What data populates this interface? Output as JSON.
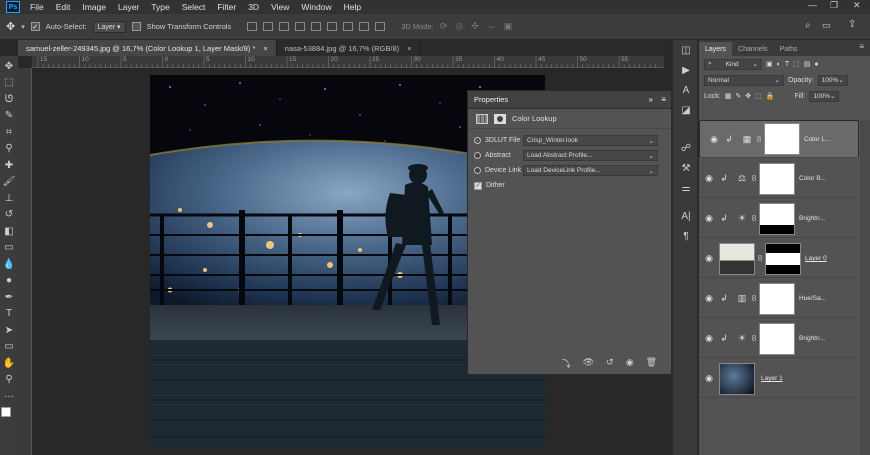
{
  "app": {
    "logo": "Ps"
  },
  "menu": [
    "File",
    "Edit",
    "Image",
    "Layer",
    "Type",
    "Select",
    "Filter",
    "3D",
    "View",
    "Window",
    "Help"
  ],
  "window_controls": [
    "—",
    "❐",
    "✕"
  ],
  "options": {
    "auto_select_label": "Auto-Select:",
    "auto_select_value": "Layer",
    "transform_label": "Show Transform Controls",
    "mode_3d": "3D Mode:"
  },
  "tabs": [
    {
      "label": "samuel-zeller-249345.jpg @ 16,7% (Color Lookup 1, Layer Mask/8) *",
      "close": "×"
    },
    {
      "label": "nasa-53884.jpg @ 16,7% (RGB/8)",
      "close": "×"
    }
  ],
  "ruler_ticks": [
    "15",
    "10",
    "5",
    "0",
    "5",
    "10",
    "15",
    "20",
    "25",
    "30",
    "35",
    "40",
    "45",
    "50",
    "55"
  ],
  "properties": {
    "panel_title": "Properties",
    "adjustment_title": "Color Lookup",
    "rows": [
      {
        "label": "3DLUT File",
        "value": "Crisp_Winter.look",
        "selected": true
      },
      {
        "label": "Abstract",
        "value": "Load Abstract Profile...",
        "selected": false
      },
      {
        "label": "Device Link",
        "value": "Load DeviceLink Profile...",
        "selected": false
      }
    ],
    "dither_label": "Dither"
  },
  "layers_panel": {
    "tabs": [
      "Layers",
      "Channels",
      "Paths"
    ],
    "kind_label": "Kind",
    "blend_mode": "Normal",
    "opacity_label": "Opacity:",
    "opacity_value": "100%",
    "lock_label": "Lock:",
    "fill_label": "Fill:",
    "fill_value": "100%",
    "layers": [
      {
        "name": "Color L...",
        "icon": "grid-icon",
        "selected": true
      },
      {
        "name": "Color B...",
        "icon": "balance-icon",
        "selected": false
      },
      {
        "name": "Brightn...",
        "icon": "sun-icon",
        "selected": false
      },
      {
        "name": "Layer 0",
        "icon": "",
        "selected": false
      },
      {
        "name": "Hue/Sa...",
        "icon": "hue-icon",
        "selected": false
      },
      {
        "name": "Brightn...",
        "icon": "sun-icon",
        "selected": false
      },
      {
        "name": "Layer 1",
        "icon": "",
        "selected": false
      }
    ]
  }
}
